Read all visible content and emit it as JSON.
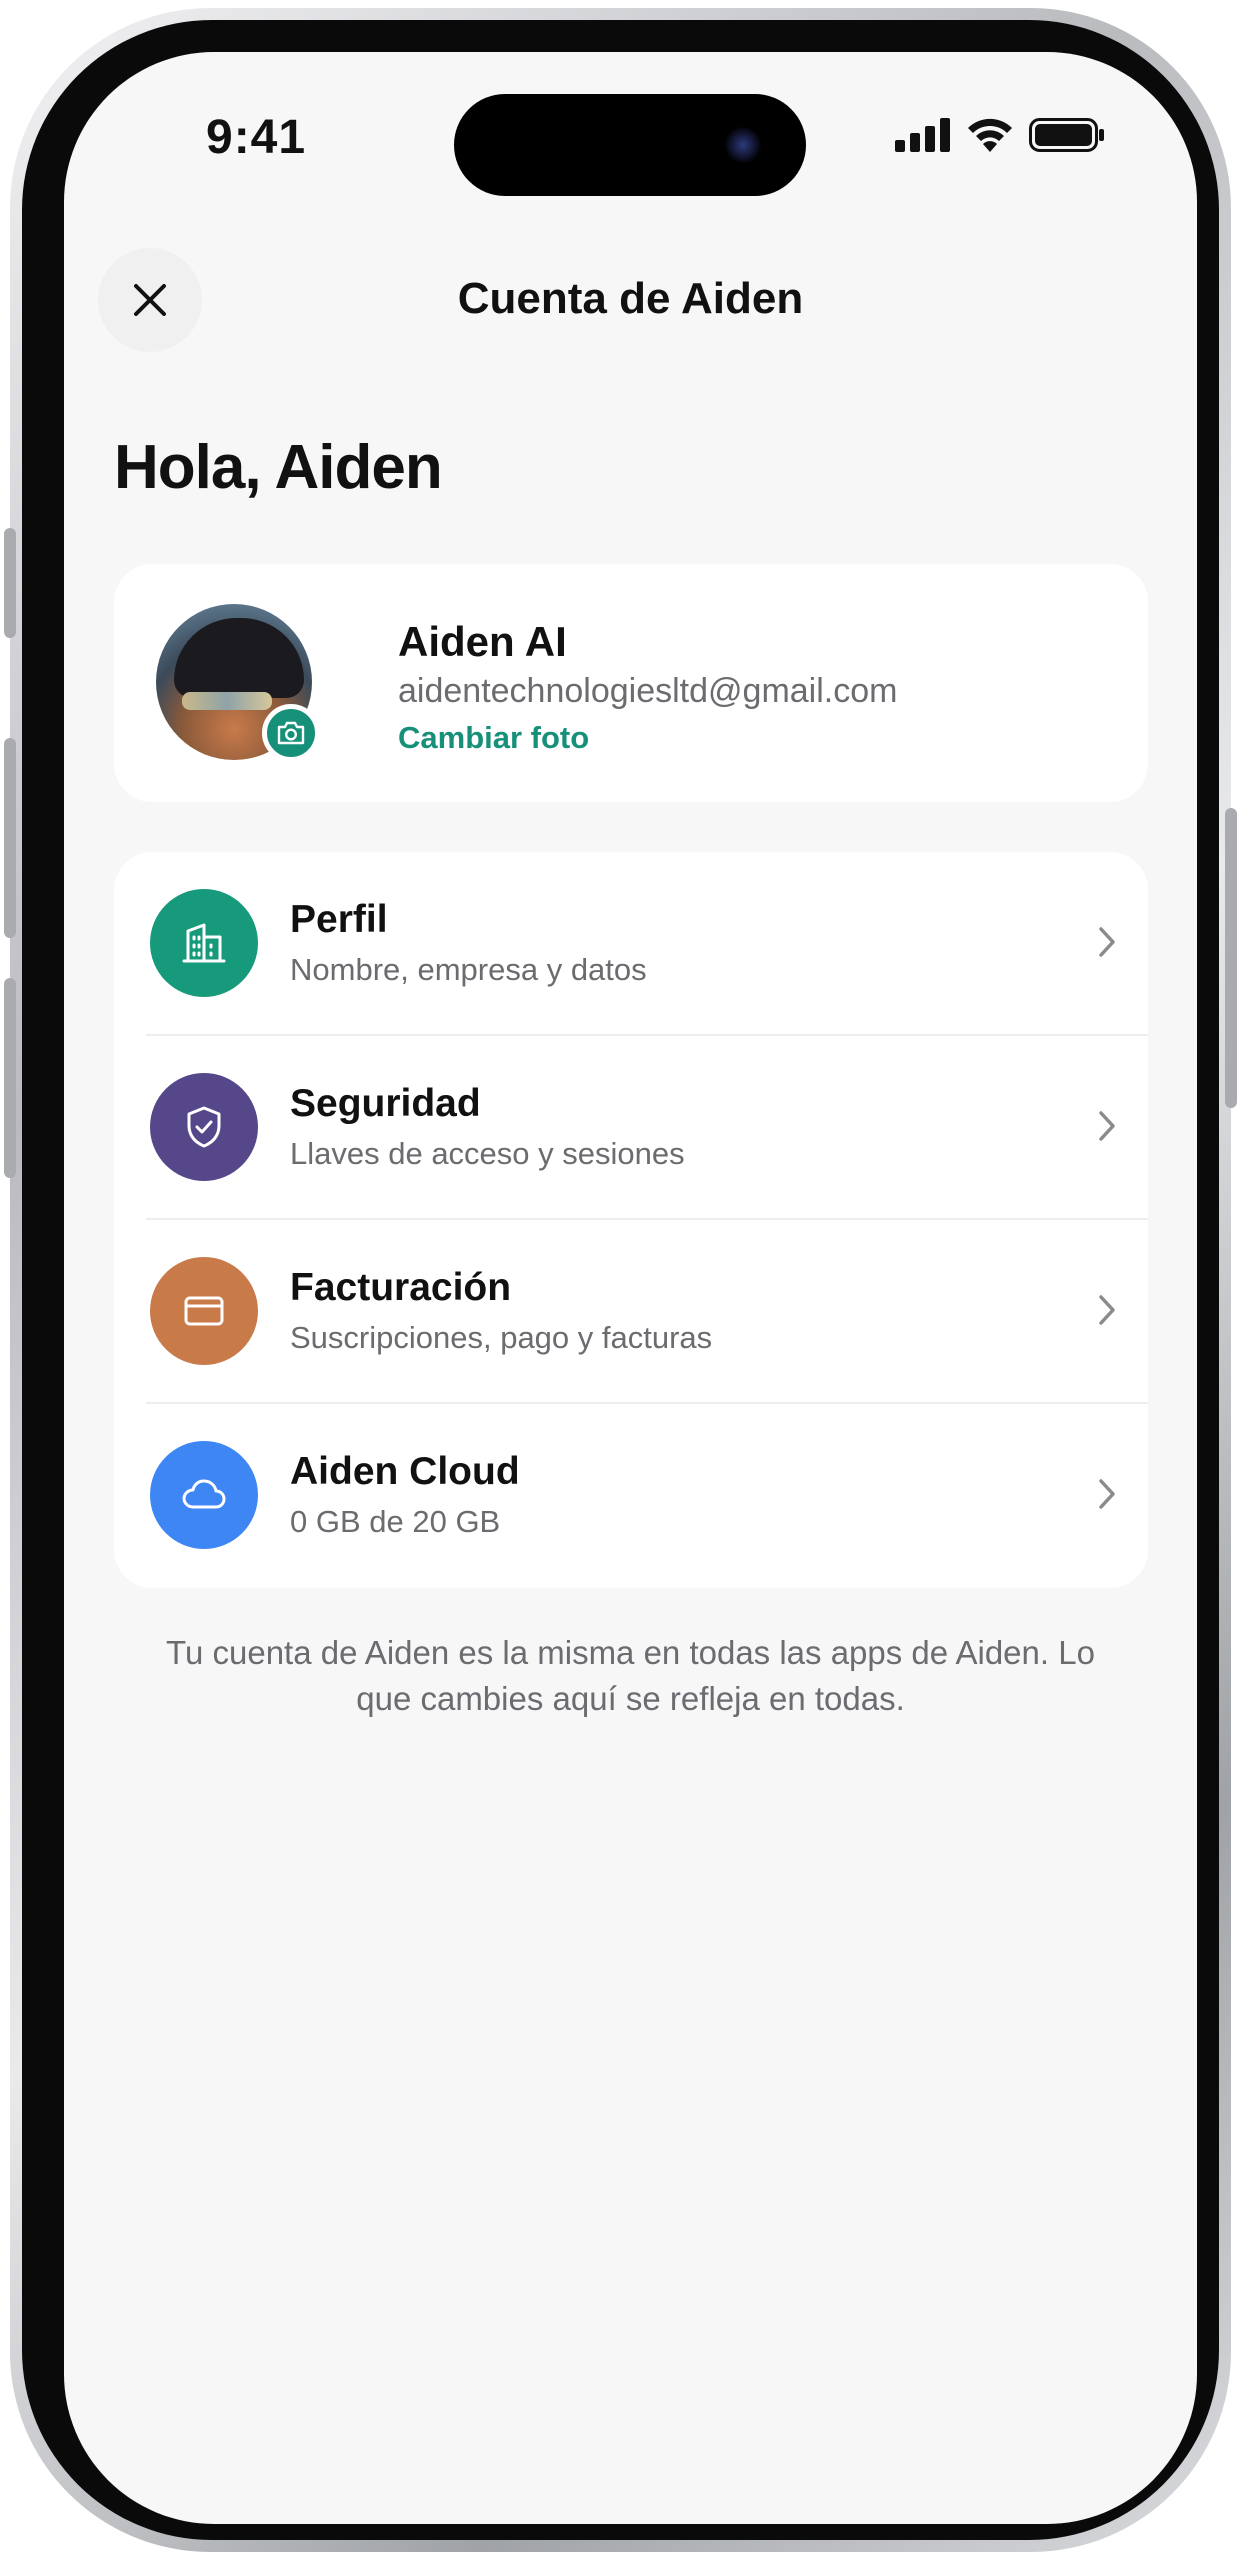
{
  "status_bar": {
    "time": "9:41"
  },
  "header": {
    "title": "Cuenta de Aiden"
  },
  "greeting": "Hola, Aiden",
  "profile": {
    "name": "Aiden AI",
    "email": "aidentechnologiesltd@gmail.com",
    "change_photo_label": "Cambiar foto"
  },
  "menu": {
    "items": [
      {
        "title": "Perfil",
        "subtitle": "Nombre, empresa y datos",
        "icon": "building-icon",
        "color": "#179a7b"
      },
      {
        "title": "Seguridad",
        "subtitle": "Llaves de acceso y sesiones",
        "icon": "shield-check-icon",
        "color": "#55478a"
      },
      {
        "title": "Facturación",
        "subtitle": "Suscripciones, pago y facturas",
        "icon": "credit-card-icon",
        "color": "#c97a49"
      },
      {
        "title": "Aiden Cloud",
        "subtitle": "0 GB de 20 GB",
        "icon": "cloud-icon",
        "color": "#3d86f3"
      }
    ]
  },
  "footer_note": "Tu cuenta de Aiden es la misma en todas las apps de Aiden. Lo que cambies aquí se refleja en todas.",
  "colors": {
    "accent": "#17907a",
    "background": "#f7f7f8"
  }
}
